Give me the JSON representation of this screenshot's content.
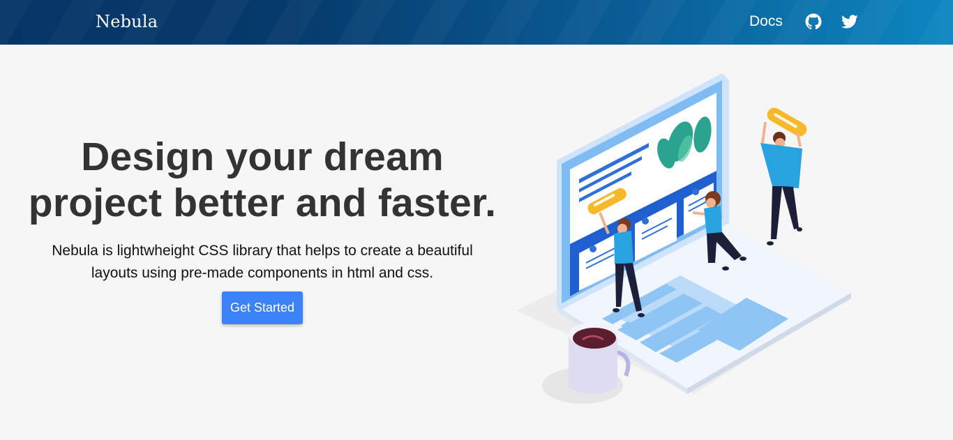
{
  "navbar": {
    "brand": "Nebula",
    "docs_label": "Docs",
    "icons": [
      "github-icon",
      "twitter-icon"
    ],
    "gradient_colors": [
      "#053566",
      "#0d86c0"
    ]
  },
  "hero": {
    "title_line1": "Design your dream",
    "title_line2": "project better and faster.",
    "subtitle_line1": "Nebula is lightwheight CSS library that helps to create a beautiful",
    "subtitle_line2": "layouts using pre-made components in html and css.",
    "cta_label": "Get Started",
    "cta_color": "#3b82f6"
  },
  "illustration": {
    "subject": "isometric laptop with people building a web layout and a coffee cup"
  }
}
